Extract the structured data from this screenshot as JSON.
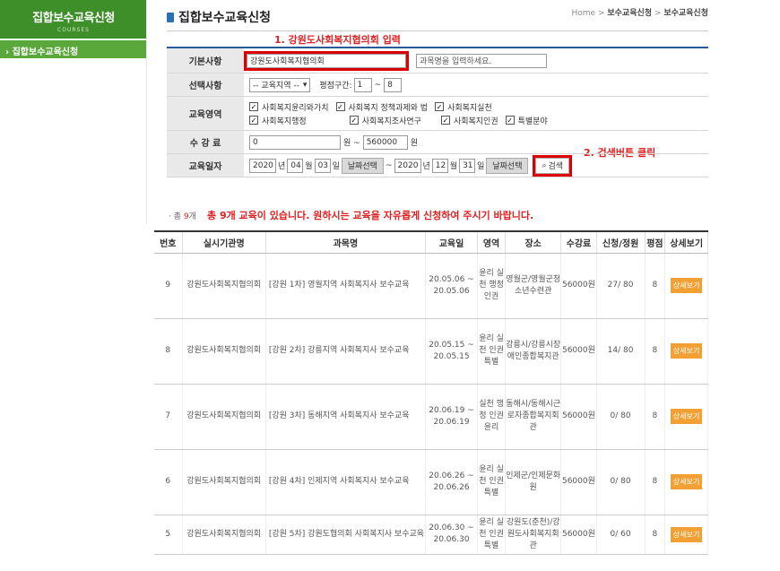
{
  "sidebar": {
    "title": "집합보수교육신청",
    "subtitle": "COURSES",
    "item": "집합보수교육신청"
  },
  "header": {
    "title": "집합보수교육신청",
    "breadcrumb_home": "Home",
    "breadcrumb_1": "보수교육신청",
    "breadcrumb_2": "보수교육신청"
  },
  "annotations": {
    "step1": "1. 강원도사회복지협의회 입력",
    "step2": "2. 검색버튼 클릭"
  },
  "form": {
    "basic_label": "기본사항",
    "org_value": "강원도사회복지협의회",
    "course_placeholder": "과목명을 입력하세요.",
    "select_label": "선택사항",
    "region_value": "-- 교육지역 --",
    "rating_label": "평점구간:",
    "rating_from": "1",
    "rating_tilde": "~",
    "rating_to": "8",
    "area_label": "교육영역",
    "areas_row1": [
      "사회복지윤리와가치",
      "사회복지 정책과제와 법",
      "사회복지실천"
    ],
    "areas_row2": [
      "사회복지행정",
      "사회복지조사연구",
      "사회복지인권",
      "특별분야"
    ],
    "fee_label": "수 강 료",
    "fee_from": "0",
    "fee_mid": "원 ~",
    "fee_to": "560000",
    "fee_unit": "원",
    "date_label": "교육일자",
    "start_year": "2020",
    "start_month": "04",
    "start_day": "03",
    "end_year": "2020",
    "end_month": "12",
    "end_day": "31",
    "year_unit": "년",
    "month_unit": "월",
    "day_unit": "일",
    "date_btn": "날짜선택",
    "search_btn": "검색"
  },
  "summary": {
    "prefix": "· 총",
    "count": "9",
    "suffix": "개",
    "notice": "총 9개 교육이 있습니다. 원하시는 교육을 자유롭게 신청하여 주시기 바랍니다."
  },
  "table": {
    "headers": [
      "번호",
      "실시기관명",
      "과목명",
      "교육일",
      "영역",
      "장소",
      "수강료",
      "신청/정원",
      "평점",
      "상세보기"
    ],
    "rows": [
      {
        "no": "9",
        "org": "강원도사회복지협의회",
        "course": "[강원 1차] 영월지역 사회복지사 보수교육",
        "date": "20.05.06 ~ 20.05.06",
        "area": "윤리 실천 행정 인권",
        "place": "영월군/영월군청소년수련관",
        "fee": "56000원",
        "apply": "27/ 80",
        "score": "8",
        "detail": "상세보기"
      },
      {
        "no": "8",
        "org": "강원도사회복지협의회",
        "course": "[강원 2차] 강릉지역 사회복지사 보수교육",
        "date": "20.05.15 ~ 20.05.15",
        "area": "윤리 실천 인권 특별",
        "place": "강릉시/강릉시장애인종합복지관",
        "fee": "56000원",
        "apply": "14/ 80",
        "score": "8",
        "detail": "상세보기"
      },
      {
        "no": "7",
        "org": "강원도사회복지협의회",
        "course": "[강원 3차] 동해지역 사회복지사 보수교육",
        "date": "20.06.19 ~ 20.06.19",
        "area": "실천 행정 인권 윤리",
        "place": "동해시/동해시근로자종합복지회관",
        "fee": "56000원",
        "apply": "0/ 80",
        "score": "8",
        "detail": "상세보기"
      },
      {
        "no": "6",
        "org": "강원도사회복지협의회",
        "course": "[강원 4차] 인제지역 사회복지사 보수교육",
        "date": "20.06.26 ~ 20.06.26",
        "area": "윤리 실천 인권 특별",
        "place": "인제군/인제문화원",
        "fee": "56000원",
        "apply": "0/ 80",
        "score": "8",
        "detail": "상세보기"
      },
      {
        "no": "5",
        "org": "강원도사회복지협의회",
        "course": "[강원 5차] 강원도협의회 사회복지사 보수교육",
        "date": "20.06.30 ~ 20.06.30",
        "area": "윤리 실천 인권 특별",
        "place": "강원도(춘천)/강원도사회복지회관",
        "fee": "56000원",
        "apply": "0/ 60",
        "score": "8",
        "detail": "상세보기"
      }
    ]
  }
}
